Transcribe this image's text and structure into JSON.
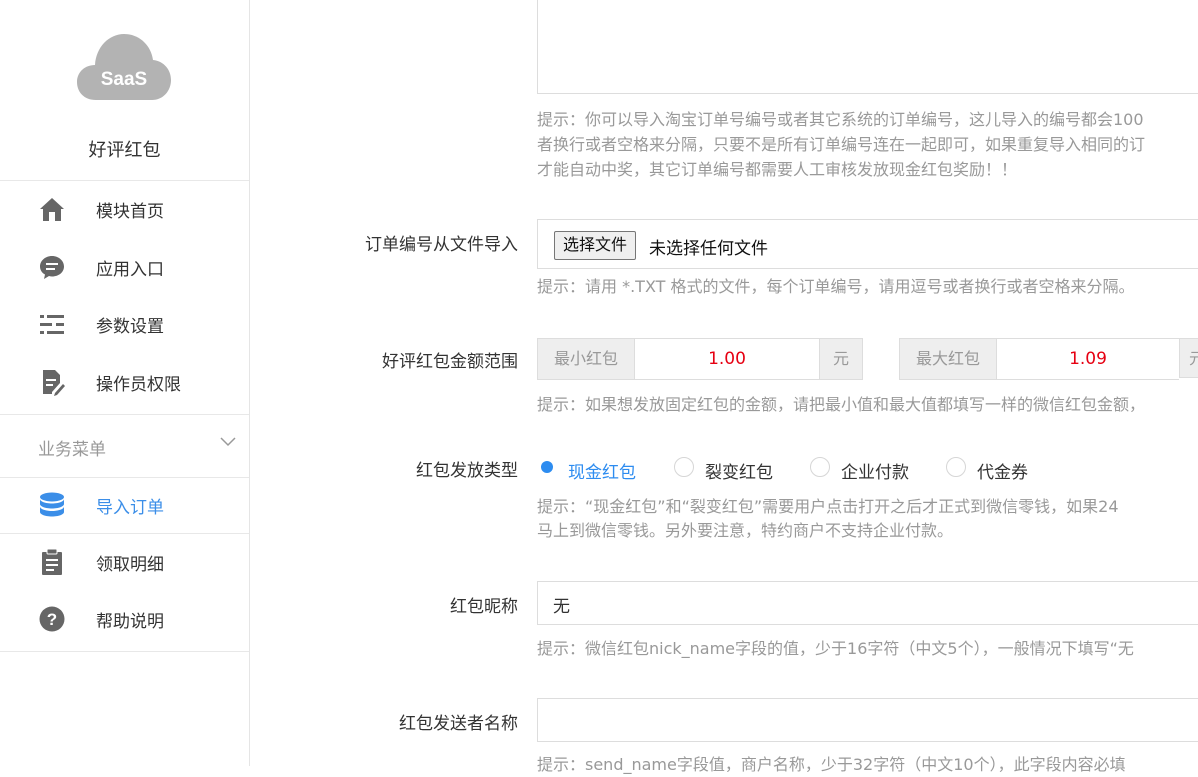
{
  "sidebar": {
    "app_name": "好评红包",
    "logo_text": "SaaS",
    "items": [
      {
        "label": "模块首页",
        "icon": "home-icon"
      },
      {
        "label": "应用入口",
        "icon": "chat-icon"
      },
      {
        "label": "参数设置",
        "icon": "list-settings-icon"
      },
      {
        "label": "操作员权限",
        "icon": "document-edit-icon"
      }
    ],
    "section": {
      "label": "业务菜单"
    },
    "sub_items": [
      {
        "label": "导入订单",
        "icon": "database-icon",
        "active": true
      },
      {
        "label": "领取明细",
        "icon": "clipboard-icon"
      },
      {
        "label": "帮助说明",
        "icon": "help-icon"
      }
    ]
  },
  "form": {
    "import_hint_lines": [
      "提示：你可以导入淘宝订单号编号或者其它系统的订单编号，这儿导入的编号都会100",
      "者换行或者空格来分隔，只要不是所有订单编号连在一起即可，如果重复导入相同的订",
      "才能自动中奖，其它订单编号都需要人工审核发放现金红包奖励！！"
    ],
    "file_import": {
      "label": "订单编号从文件导入",
      "button": "选择文件",
      "status": "未选择任何文件",
      "hint": "提示：请用 *.TXT 格式的文件，每个订单编号，请用逗号或者换行或者空格来分隔。"
    },
    "amount_range": {
      "label": "好评红包金额范围",
      "min_label": "最小红包",
      "min_value": "1.00",
      "unit": "元",
      "max_label": "最大红包",
      "max_value": "1.09",
      "unit2": "元",
      "hint": "提示：如果想发放固定红包的金额，请把最小值和最大值都填写一样的微信红包金额，"
    },
    "type": {
      "label": "红包发放类型",
      "options": [
        "现金红包",
        "裂变红包",
        "企业付款",
        "代金券"
      ],
      "selected": 0,
      "hint_lines": [
        "提示：“现金红包”和“裂变红包”需要用户点击打开之后才正式到微信零钱，如果24",
        "马上到微信零钱。另外要注意，特约商户不支持企业付款。"
      ]
    },
    "nick_name": {
      "label": "红包昵称",
      "value": "无",
      "hint": "提示：微信红包nick_name字段的值，少于16字符（中文5个），一般情况下填写“无"
    },
    "send_name": {
      "label": "红包发送者名称",
      "value": "",
      "hint": "提示：send_name字段值，商户名称，少于32字符（中文10个），此字段内容必填"
    }
  }
}
